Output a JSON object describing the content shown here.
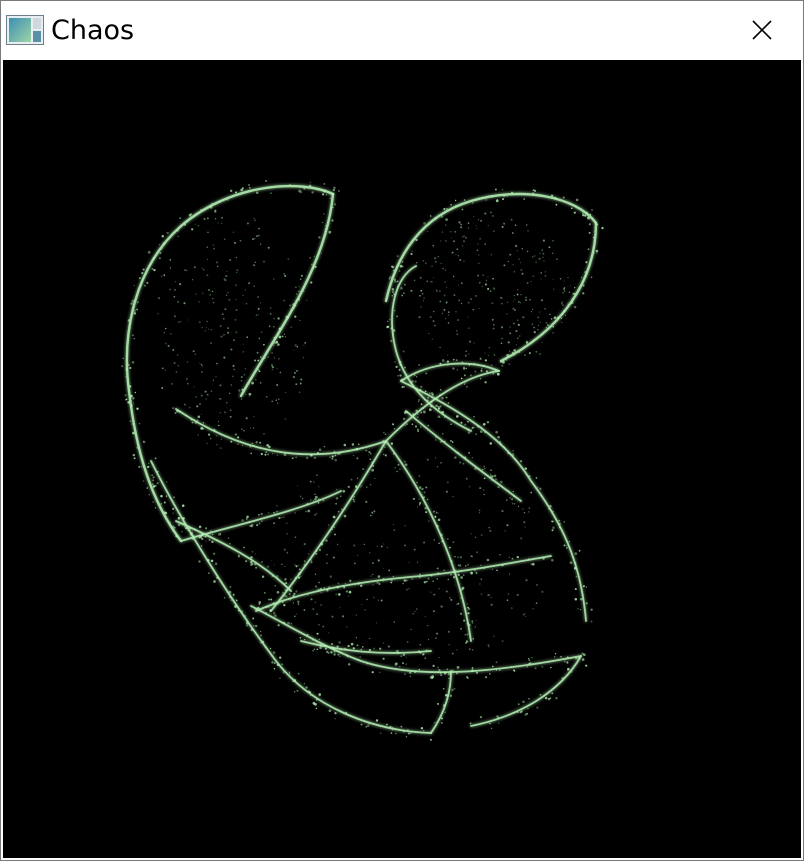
{
  "window": {
    "title": "Chaos",
    "app_icon": "app-window-icon",
    "close_icon": "close-icon"
  },
  "colors": {
    "canvas_background": "#000000",
    "attractor": "#b4f0b4",
    "titlebar": "#ffffff"
  },
  "content": {
    "figure": "strange-attractor-point-cloud"
  }
}
